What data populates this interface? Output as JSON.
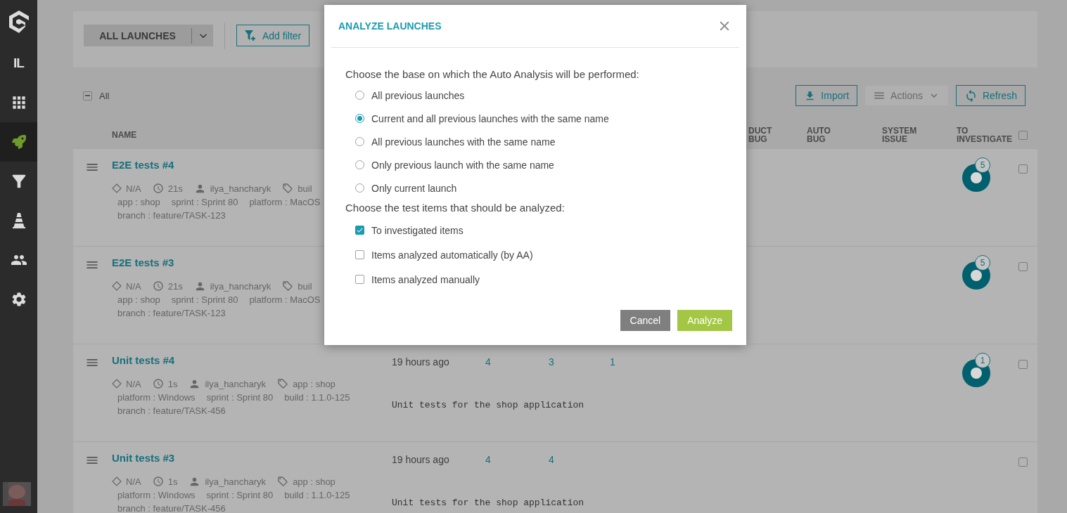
{
  "sidebar": {
    "project": "IL",
    "nav": [
      {
        "selected": false
      },
      {
        "selected": true
      },
      {
        "selected": false
      },
      {
        "selected": false
      },
      {
        "selected": false
      },
      {
        "selected": false
      }
    ]
  },
  "toolbar": {
    "filter_select": "ALL LAUNCHES",
    "add_filter": "Add filter"
  },
  "actions": {
    "select_all": {
      "label": "All",
      "indeterminate": true
    },
    "buttons": [
      {
        "kind": "import",
        "label": "Import",
        "disabled": false
      },
      {
        "kind": "actions",
        "label": "Actions",
        "disabled": true
      },
      {
        "kind": "refresh",
        "label": "Refresh",
        "disabled": false
      }
    ]
  },
  "table": {
    "columns": [
      {
        "label": "NAME"
      },
      {
        "label": "DUCT BUG"
      },
      {
        "label": "AUTO BUG"
      },
      {
        "label": "SYSTEM ISSUE"
      },
      {
        "label": "TO INVESTIGATE"
      }
    ],
    "header_checked": false,
    "rows": [
      {
        "name": "E2E tests #4",
        "status": "N/A",
        "duration": "21s",
        "owner": "ilya_hancharyk",
        "tag_lines": [
          [
            "buil"
          ],
          [
            "app : shop",
            "sprint : Sprint 80",
            "platform : MacOS"
          ],
          [
            "branch : feature/TASK-123"
          ]
        ],
        "to_investigate": "5",
        "selected": false
      },
      {
        "name": "E2E tests #3",
        "status": "N/A",
        "duration": "21s",
        "owner": "ilya_hancharyk",
        "tag_lines": [
          [
            "buil"
          ],
          [
            "app : shop",
            "sprint : Sprint 80",
            "platform : MacOS"
          ],
          [
            "branch : feature/TASK-123"
          ]
        ],
        "to_investigate": "5",
        "selected": false
      },
      {
        "name": "Unit tests #4",
        "status": "N/A",
        "duration": "1s",
        "owner": "ilya_hancharyk",
        "tag_lines": [
          [
            "app : shop"
          ],
          [
            "platform : Windows",
            "sprint : Sprint 80",
            "build : 1.1.0-125"
          ],
          [
            "branch : feature/TASK-456"
          ]
        ],
        "start_time": "19 hours ago",
        "total": "4",
        "passed": "3",
        "failed": "1",
        "description": "Unit tests for the shop application",
        "to_investigate": "1",
        "selected": false
      },
      {
        "name": "Unit tests #3",
        "status": "N/A",
        "duration": "1s",
        "owner": "ilya_hancharyk",
        "tag_lines": [
          [
            "app : shop"
          ],
          [
            "platform : Windows",
            "sprint : Sprint 80",
            "build : 1.1.0-125"
          ],
          [
            "branch : feature/TASK-456"
          ]
        ],
        "start_time": "19 hours ago",
        "total": "4",
        "passed": "4",
        "description": "Unit tests for the shop application",
        "selected": false
      }
    ]
  },
  "modal": {
    "title": "ANALYZE LAUNCHES",
    "base_prompt": "Choose the base on which the Auto Analysis will be performed:",
    "base_options": [
      {
        "label": "All previous launches",
        "selected": false
      },
      {
        "label": "Current and all previous launches with the same name",
        "selected": true
      },
      {
        "label": "All previous launches with the same name",
        "selected": false
      },
      {
        "label": "Only previous launch with the same name",
        "selected": false
      },
      {
        "label": "Only current launch",
        "selected": false
      }
    ],
    "items_prompt": "Choose the test items that should be analyzed:",
    "item_options": [
      {
        "label": "To investigated items",
        "checked": true
      },
      {
        "label": "Items analyzed automatically (by AA)",
        "checked": false
      },
      {
        "label": "Items analyzed manually",
        "checked": false
      }
    ],
    "buttons": [
      {
        "kind": "cancel",
        "label": "Cancel"
      },
      {
        "kind": "primary",
        "label": "Analyze"
      }
    ]
  }
}
